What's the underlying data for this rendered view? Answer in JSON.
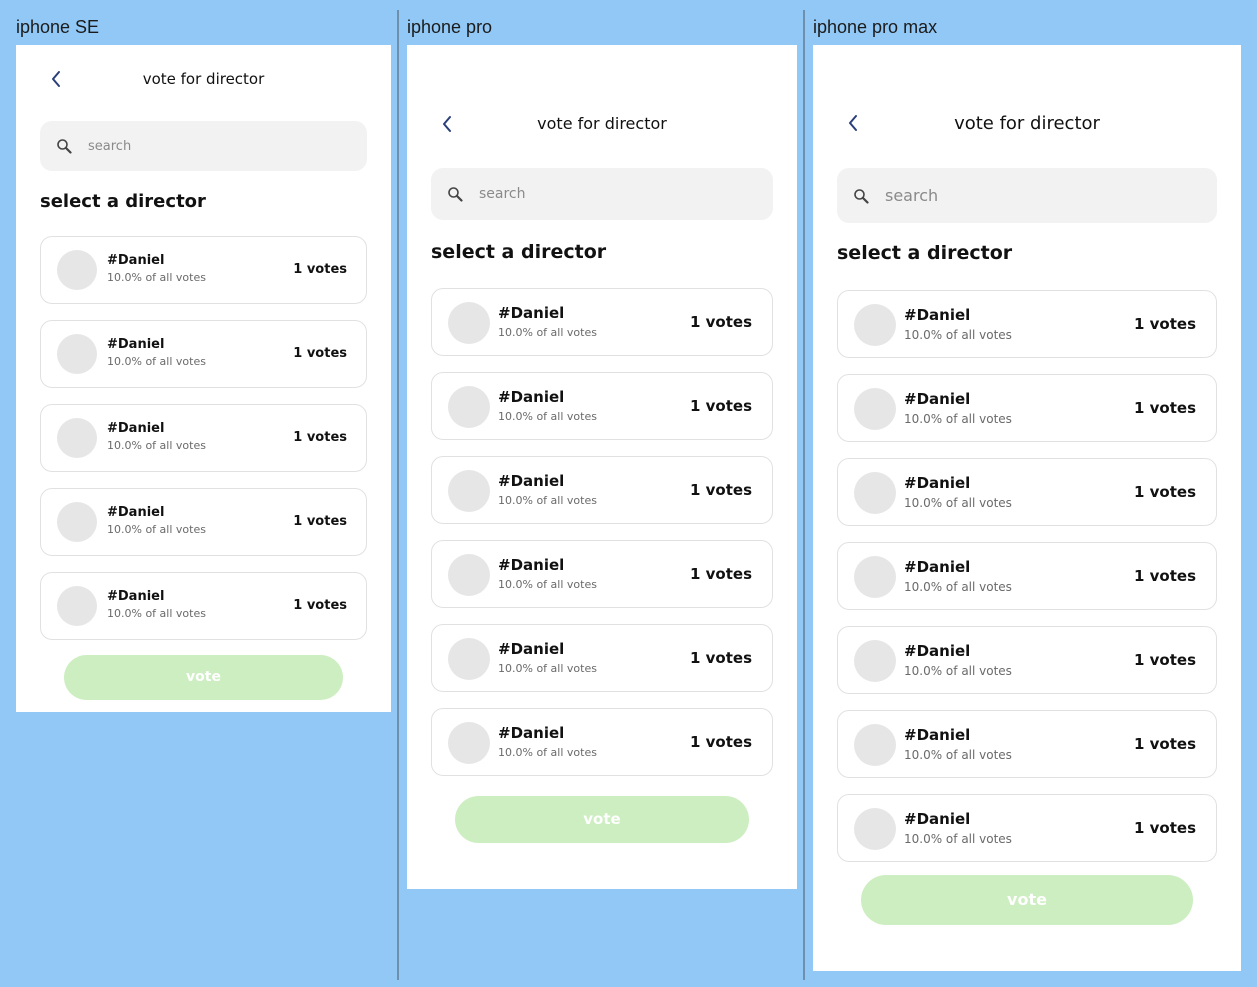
{
  "frames": [
    {
      "label": "iphone SE"
    },
    {
      "label": "iphone pro"
    },
    {
      "label": "iphone pro max"
    }
  ],
  "screen": {
    "title": "vote for director",
    "back_icon": "chevron-left-icon",
    "search": {
      "placeholder": "search",
      "icon": "search-icon"
    },
    "section_title": "select a director",
    "candidate": {
      "name": "#Daniel",
      "percent_text": "10.0% of all votes",
      "votes_text": "1 votes"
    },
    "vote_label": "vote"
  },
  "colors": {
    "canvas": "#91c8f5",
    "screen": "#ffffff",
    "search_bg": "#f2f2f2",
    "avatar": "#e6e6e6",
    "vote_button": "#cdeec1",
    "back_icon": "#2b3f7a"
  }
}
